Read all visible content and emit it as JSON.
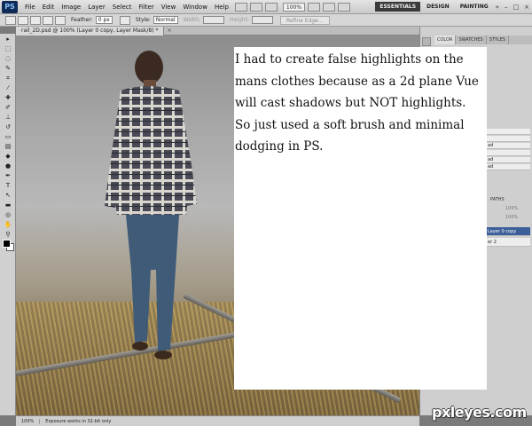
{
  "app": {
    "logo": "PS"
  },
  "menu": {
    "items": [
      "File",
      "Edit",
      "Image",
      "Layer",
      "Select",
      "Filter",
      "View",
      "Window",
      "Help"
    ]
  },
  "topbar": {
    "zoom": "100%",
    "workspaces": [
      "ESSENTIALS",
      "DESIGN",
      "PAINTING"
    ],
    "more": "»",
    "window_controls": [
      "–",
      "□",
      "×"
    ]
  },
  "options": {
    "feather_label": "Feather:",
    "feather_value": "0 px",
    "style_label": "Style:",
    "style_value": "Normal",
    "width_label": "Width:",
    "height_label": "Height:",
    "refine_button": "Refine Edge..."
  },
  "document": {
    "tab_title": "rail_2D.psd @ 100% (Layer 0 copy, Layer Mask/8) *",
    "close": "×"
  },
  "panels": {
    "tabs": [
      "COLOR",
      "SWATCHES",
      "STYLES"
    ],
    "paths_tab": "PATHS",
    "opacity": "100%",
    "fill": "100%",
    "layer_selected": "Layer 0 copy",
    "layer_other": "er 2",
    "row_labels": [
      "",
      "",
      "ad",
      "",
      "ad",
      "ad"
    ]
  },
  "status": {
    "zoom": "100%",
    "message": "Exposure works in 32-bit only"
  },
  "annotation": {
    "text": "I had to create false highlights on the mans clothes because as a 2d plane Vue will cast shadows but NOT highlights.  So just used a soft brush and minimal dodging in PS."
  },
  "watermark": {
    "text": "pxleyes.com"
  }
}
